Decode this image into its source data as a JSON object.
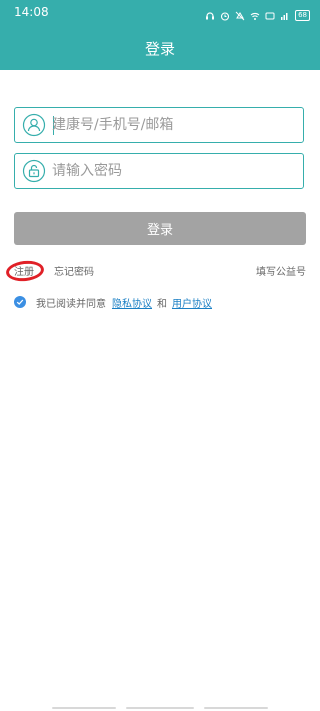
{
  "status_bar": {
    "time": "14:08",
    "icons": [
      "headset-icon",
      "alarm-icon",
      "mute-icon",
      "wifi-icon",
      "nfc-icon",
      "signal-icon"
    ],
    "battery": "68"
  },
  "header": {
    "title": "登录"
  },
  "form": {
    "account_placeholder": "建康号/手机号/邮箱",
    "password_placeholder": "请输入密码",
    "login_label": "登录"
  },
  "links": {
    "register": "注册",
    "forgot": "忘记密码",
    "public_account": "填写公益号"
  },
  "agreement": {
    "prefix": "我已阅读并同意",
    "privacy": "隐私协议",
    "and": "和",
    "user": "用户协议",
    "checked": true
  },
  "colors": {
    "primary": "#36aeac",
    "button_disabled": "#a3a3a3",
    "link": "#1a7fc4",
    "annotation": "#e02027"
  }
}
